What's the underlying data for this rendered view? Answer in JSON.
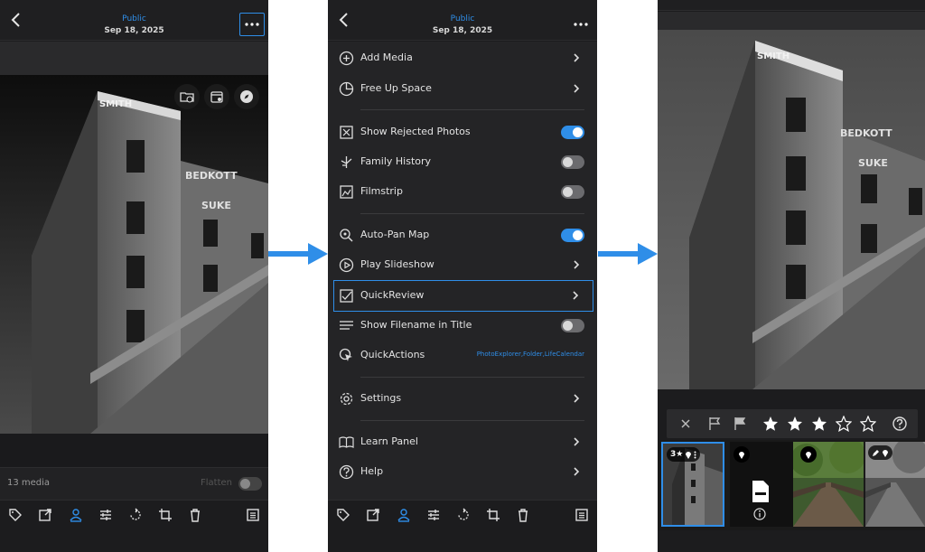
{
  "header": {
    "title": "Public",
    "date": "Sep 18, 2025"
  },
  "panel1": {
    "media_count": "13 media",
    "flatten_label": "Flatten",
    "overlay_buttons": [
      "folder-clock-icon",
      "calendar-icon",
      "compass-icon"
    ]
  },
  "menu": {
    "items": [
      {
        "label": "Add Media",
        "icon": "plus-circle-icon",
        "control": "chevron"
      },
      {
        "label": "Free Up Space",
        "icon": "pie-chart-icon",
        "control": "chevron"
      },
      {
        "label": "Show Rejected Photos",
        "icon": "reject-photos-icon",
        "control": "toggle",
        "on": true
      },
      {
        "label": "Family History",
        "icon": "family-tree-icon",
        "control": "toggle",
        "on": false
      },
      {
        "label": "Filmstrip",
        "icon": "filmstrip-icon",
        "control": "toggle",
        "on": false
      },
      {
        "label": "Auto-Pan Map",
        "icon": "map-search-icon",
        "control": "toggle",
        "on": true
      },
      {
        "label": "Play Slideshow",
        "icon": "play-circle-icon",
        "control": "chevron"
      },
      {
        "label": "QuickReview",
        "icon": "quickreview-icon",
        "control": "chevron",
        "highlighted": true
      },
      {
        "label": "Show Filename in Title",
        "icon": "lines-icon",
        "control": "toggle",
        "on": false
      },
      {
        "label": "QuickActions",
        "icon": "pointer-icon",
        "control": "text",
        "value": "PhotoExplorer,Folder,LifeCalendar"
      },
      {
        "label": "Settings",
        "icon": "gear-icon",
        "control": "chevron"
      },
      {
        "label": "Learn Panel",
        "icon": "book-icon",
        "control": "chevron"
      },
      {
        "label": "Help",
        "icon": "help-circle-icon",
        "control": "chevron"
      }
    ]
  },
  "toolbar": {
    "icons": [
      "tag-icon",
      "share-icon",
      "people-icon",
      "adjust-icon",
      "rotate-icon",
      "crop-rotate-icon",
      "trash-icon",
      "list-icon"
    ],
    "active": "people-icon"
  },
  "panel3": {
    "rating": {
      "stars_filled": 3,
      "stars_total": 5
    },
    "thumb_badge": "3★",
    "colors": {
      "accent": "#2f8ee8",
      "background": "#1c1c1e"
    }
  }
}
